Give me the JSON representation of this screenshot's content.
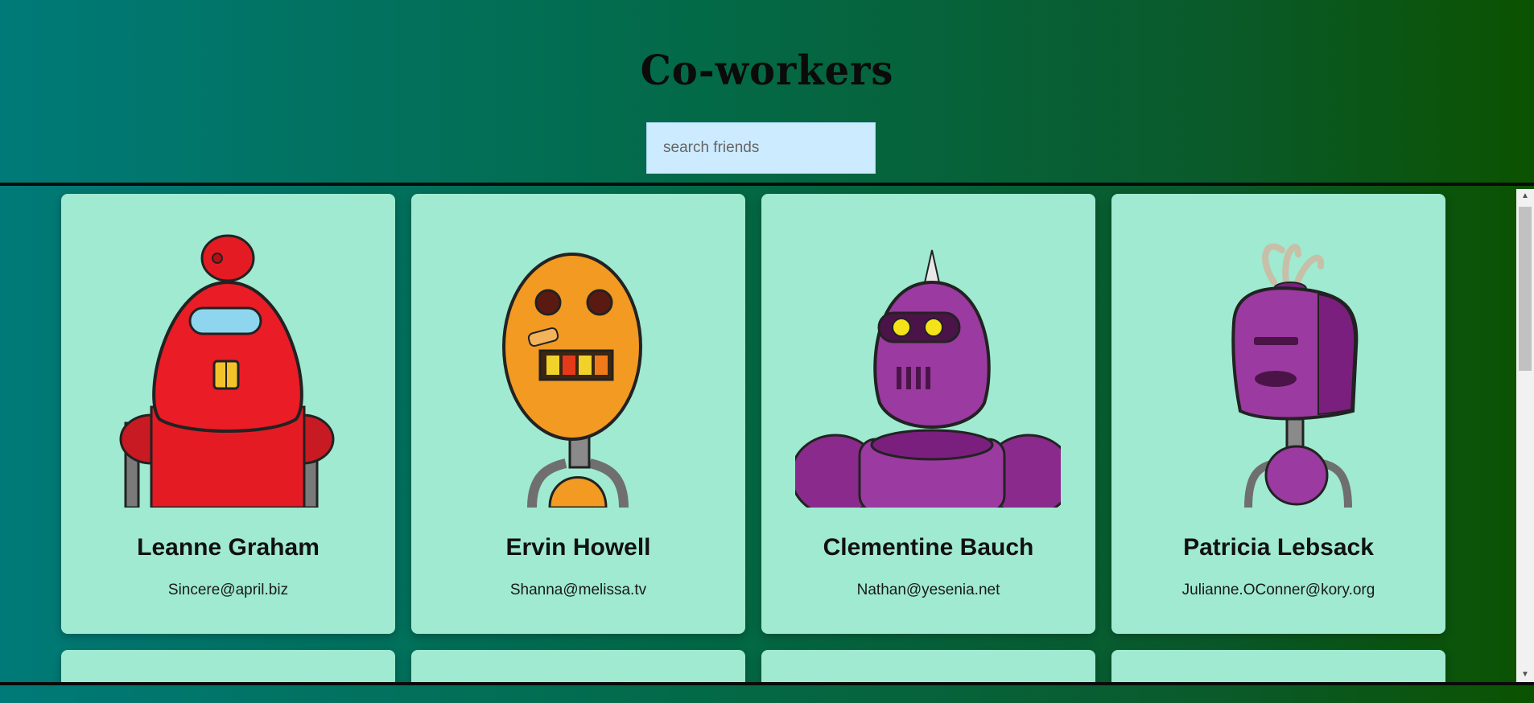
{
  "header": {
    "title": "Co-workers"
  },
  "search": {
    "placeholder": "search friends",
    "value": ""
  },
  "cards": [
    {
      "name": "Leanne Graham",
      "email": "Sincere@april.biz",
      "avatar_icon": "robot-red-avatar"
    },
    {
      "name": "Ervin Howell",
      "email": "Shanna@melissa.tv",
      "avatar_icon": "robot-orange-avatar"
    },
    {
      "name": "Clementine Bauch",
      "email": "Nathan@yesenia.net",
      "avatar_icon": "robot-purple-spike-avatar"
    },
    {
      "name": "Patricia Lebsack",
      "email": "Julianne.OConner@kory.org",
      "avatar_icon": "robot-purple-bucket-avatar"
    }
  ],
  "colors": {
    "card_background": "#9fead0",
    "search_background": "#cdebff",
    "page_gradient_start": "#007a78",
    "page_gradient_end": "#0b5200"
  }
}
